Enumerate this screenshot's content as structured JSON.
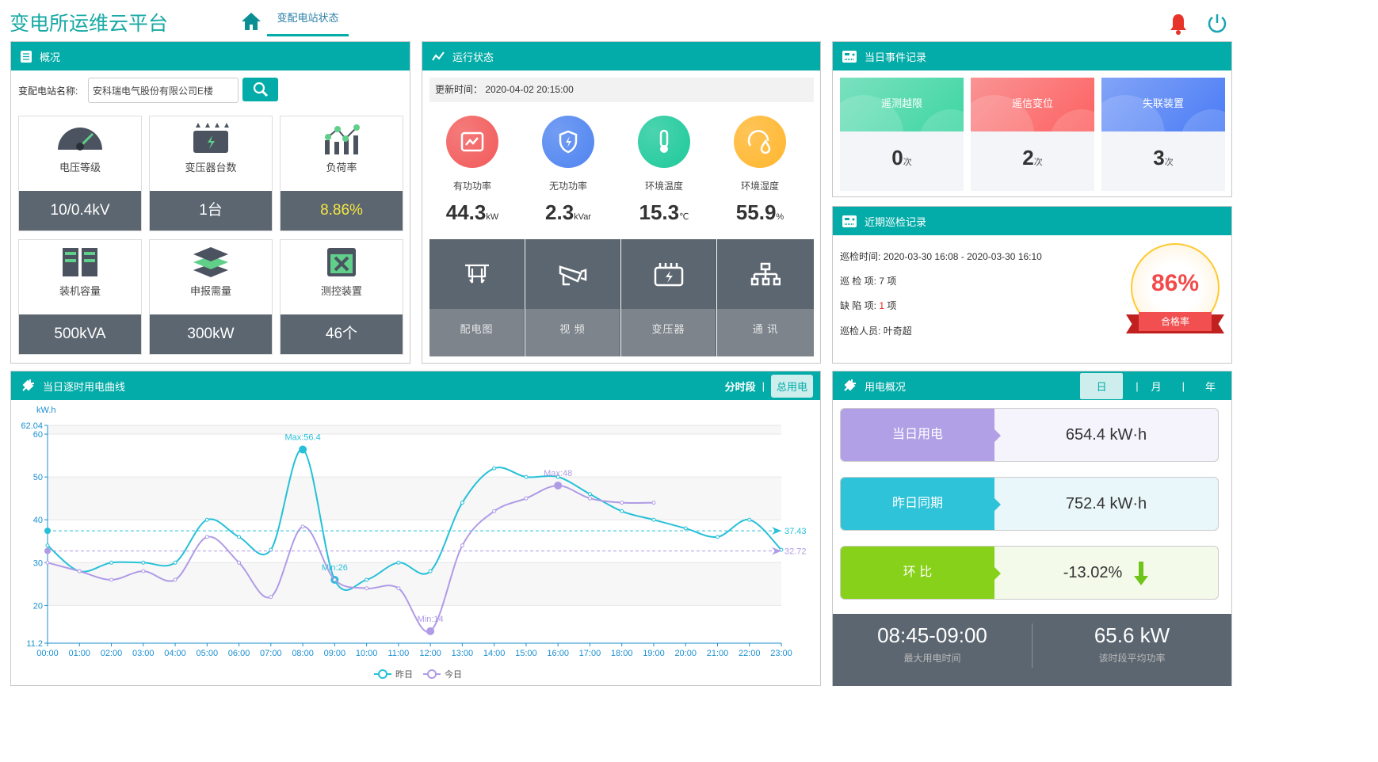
{
  "header": {
    "title": "变电所运维云平台",
    "nav_tab": "变配电站状态",
    "icons": [
      "home-icon",
      "bell-icon",
      "power-icon"
    ]
  },
  "overview": {
    "title": "概况",
    "station_label": "变配电站名称:",
    "station_value": "安科瑞电气股份有限公司E楼",
    "tiles": [
      {
        "label": "电压等级",
        "value": "10/0.4kV",
        "icon": "gauge-icon"
      },
      {
        "label": "变压器台数",
        "value": "1台",
        "icon": "transformer-icon"
      },
      {
        "label": "负荷率",
        "value": "8.86%",
        "icon": "chart-icon",
        "highlight": "#f5e642"
      },
      {
        "label": "装机容量",
        "value": "500kVA",
        "icon": "cabinet-icon"
      },
      {
        "label": "申报需量",
        "value": "300kW",
        "icon": "layers-icon"
      },
      {
        "label": "测控装置",
        "value": "46个",
        "icon": "device-icon"
      }
    ]
  },
  "status": {
    "title": "运行状态",
    "update_label": "更新时间：",
    "update_time": "2020-04-02 20:15:00",
    "metrics": [
      {
        "label": "有功功率",
        "value": "44.3",
        "unit": "kW",
        "color": "#f25a5a"
      },
      {
        "label": "无功功率",
        "value": "2.3",
        "unit": "kVar",
        "color": "#4f84f0"
      },
      {
        "label": "环境温度",
        "value": "15.3",
        "unit": "℃",
        "color": "#1ec99b"
      },
      {
        "label": "环境湿度",
        "value": "55.9",
        "unit": "%",
        "color": "#ffb62e"
      }
    ],
    "links": [
      {
        "label": "配电图",
        "icon": "distribution-diagram-icon"
      },
      {
        "label": "视 频",
        "icon": "camera-icon"
      },
      {
        "label": "变压器",
        "icon": "transformer-icon"
      },
      {
        "label": "通 讯",
        "icon": "network-icon"
      }
    ]
  },
  "events": {
    "title": "当日事件记录",
    "cards": [
      {
        "label": "遥测越限",
        "count": "0",
        "unit": "次",
        "color": "#3ed6a2"
      },
      {
        "label": "遥信变位",
        "count": "2",
        "unit": "次",
        "color": "#fd6262"
      },
      {
        "label": "失联装置",
        "count": "3",
        "unit": "次",
        "color": "#4a7cf6"
      }
    ]
  },
  "patrol": {
    "title": "近期巡检记录",
    "time_label": "巡检时间:",
    "time": "2020-03-30 16:08 - 2020-03-30 16:10",
    "items_label": "巡 检 项:",
    "items": "7",
    "defects_label": "缺 陷 项:",
    "defects": "1",
    "unit": "项",
    "person_label": "巡检人员:",
    "person": "叶奇超",
    "rate": "86%",
    "rate_label": "合格率"
  },
  "curve": {
    "title": "当日逐时用电曲线",
    "tabs": [
      "分时段",
      "总用电"
    ],
    "active_tab": "总用电",
    "separator": "|"
  },
  "chart_data": {
    "type": "line",
    "ylabel": "kW.h",
    "ylim": [
      11.2,
      62.04
    ],
    "yticks": [
      20,
      30,
      40,
      50,
      60
    ],
    "categories": [
      "00:00",
      "01:00",
      "02:00",
      "03:00",
      "04:00",
      "05:00",
      "06:00",
      "07:00",
      "08:00",
      "09:00",
      "10:00",
      "11:00",
      "12:00",
      "13:00",
      "14:00",
      "15:00",
      "16:00",
      "17:00",
      "18:00",
      "19:00",
      "20:00",
      "21:00",
      "22:00",
      "23:00"
    ],
    "series": [
      {
        "name": "昨日",
        "color": "#26c0d8",
        "values": [
          34,
          28,
          30,
          30,
          30,
          40,
          36,
          33,
          56.4,
          26,
          26,
          30,
          28,
          44,
          52,
          50,
          50,
          46,
          42,
          40,
          38,
          36,
          40,
          33
        ],
        "max_label": "Max:56.4",
        "min_label": "Min:26",
        "average": 37.43
      },
      {
        "name": "今日",
        "color": "#b09be6",
        "values": [
          30,
          28,
          26,
          28,
          26,
          36,
          30,
          22,
          38.4,
          26,
          24,
          24,
          14,
          34,
          42,
          45,
          48,
          45,
          44,
          44
        ],
        "max_label": "Max:48",
        "min_label": "Min:14",
        "average": 32.72
      }
    ],
    "grid": true,
    "legend": "bottom-center"
  },
  "usage": {
    "title": "用电概况",
    "tabs": [
      "日",
      "月",
      "年"
    ],
    "active_tab": "日",
    "separator": "|",
    "rows": [
      {
        "label": "当日用电",
        "value": "654.4 kW·h",
        "color": "#b1a0e6",
        "bg": "#f5f3fb"
      },
      {
        "label": "昨日同期",
        "value": "752.4 kW·h",
        "color": "#2ec3d8",
        "bg": "#eaf7fa"
      },
      {
        "label": "环 比",
        "value": "-13.02%",
        "color": "#88d11a",
        "bg": "#f3fae9"
      }
    ],
    "peak_time": "08:45-09:00",
    "peak_time_label": "最大用电时间",
    "avg_power": "65.6 kW",
    "avg_power_label": "该时段平均功率"
  }
}
